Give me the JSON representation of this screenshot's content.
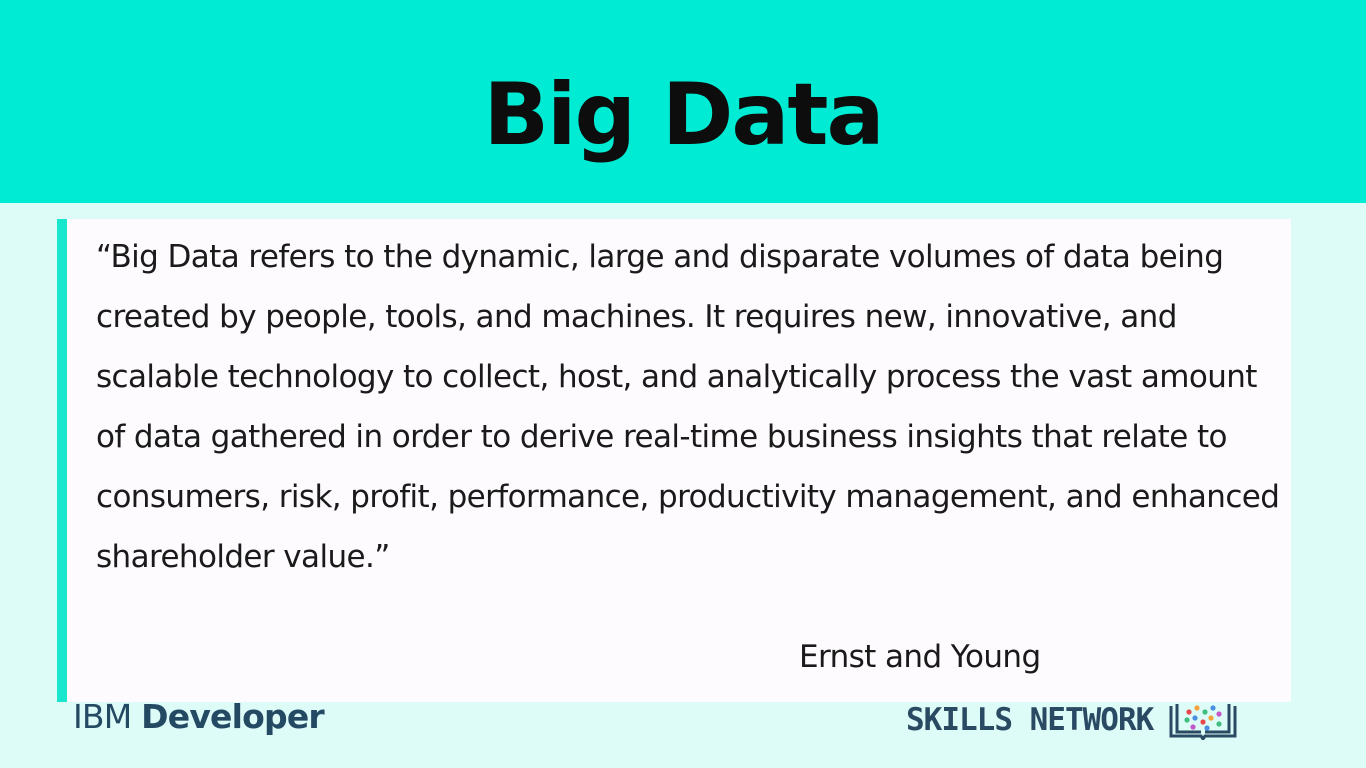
{
  "slide": {
    "title": "Big Data",
    "quote": "“Big Data refers to the dynamic, large and disparate volumes of data being created by people, tools, and machines. It requires new, innovative, and scalable technology to collect, host, and analytically process the vast amount of data gathered in order to derive real-time business insights that relate to consumers, risk, profit, performance, productivity management, and enhanced shareholder value.”",
    "author": "Ernst and Young"
  },
  "branding": {
    "ibm_word": "IBM",
    "developer_word": "Developer",
    "skills_network": "SKILLS NETWORK",
    "skills_icon": "book-network-icon"
  },
  "colors": {
    "header_band": "#00ebd3",
    "background": "#ddfbf7",
    "accent_bar": "#18e6cd",
    "logo_text": "#244a63"
  }
}
